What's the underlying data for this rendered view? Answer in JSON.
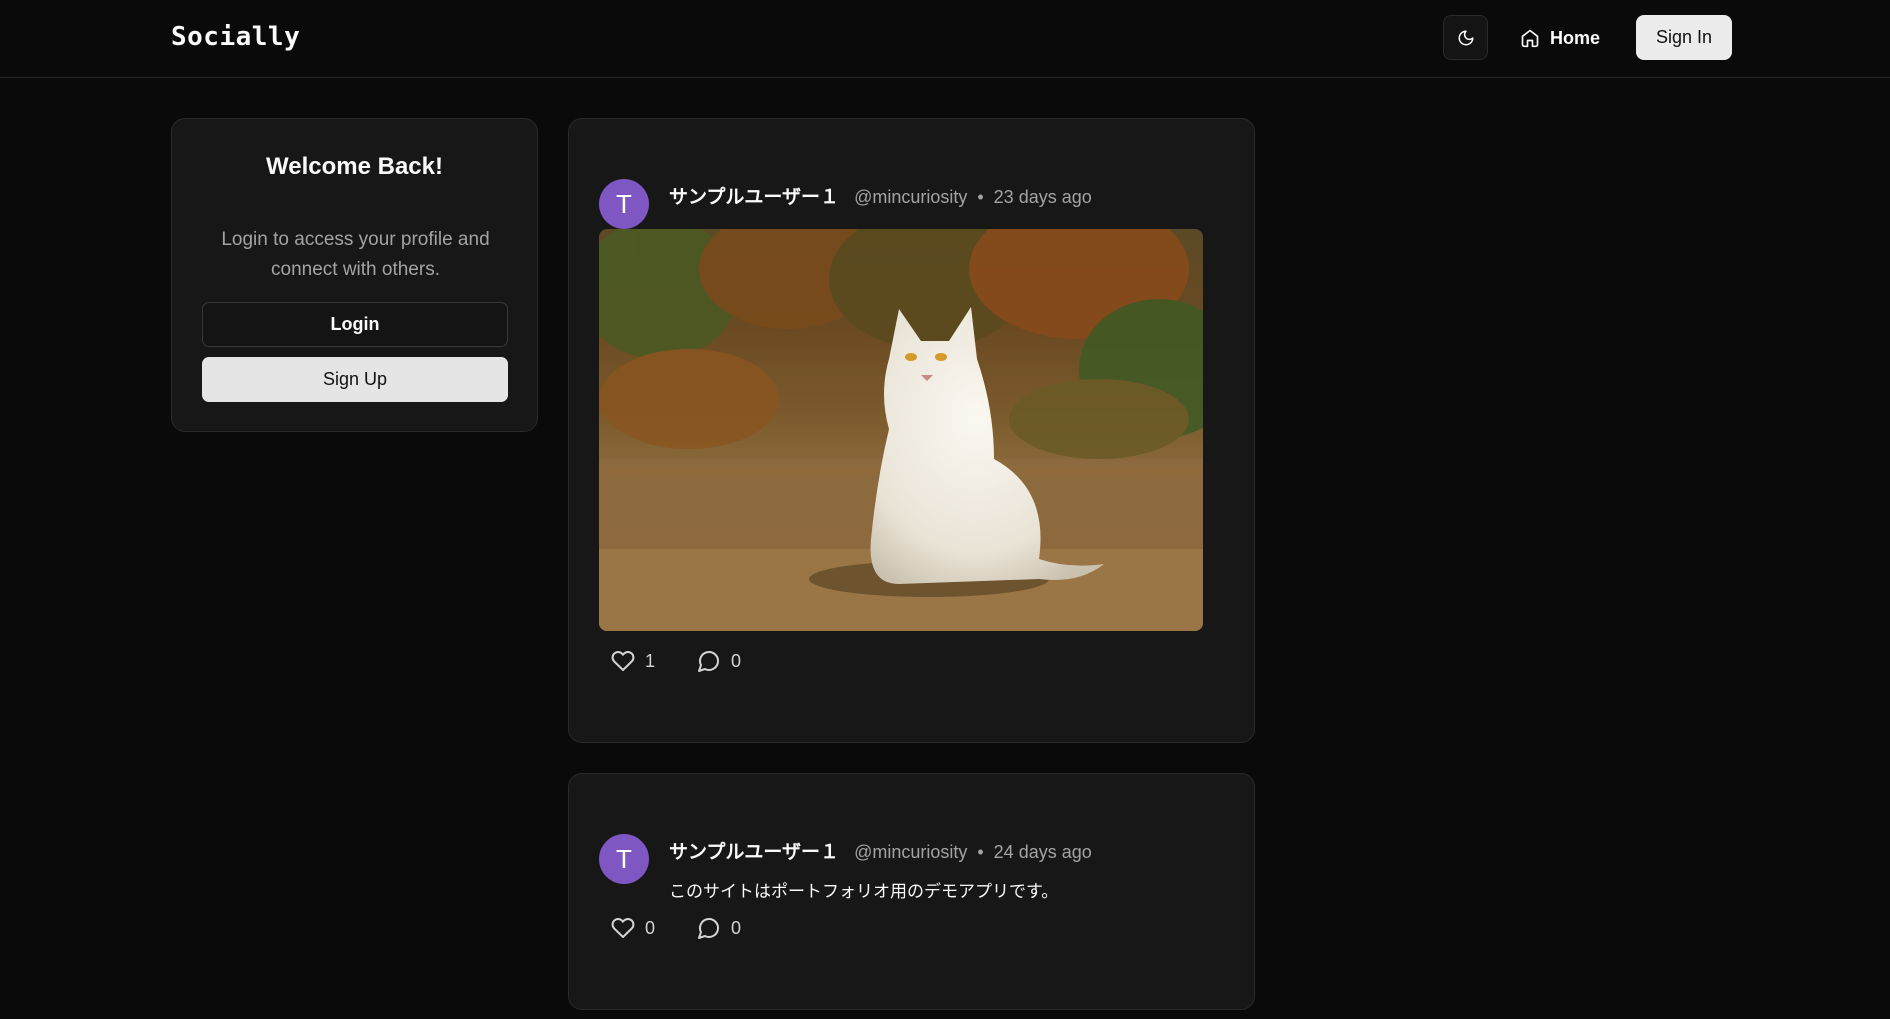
{
  "header": {
    "brand": "Socially",
    "theme_toggle_icon": "moon-icon",
    "nav_home_label": "Home",
    "sign_in_label": "Sign In"
  },
  "welcome": {
    "title": "Welcome Back!",
    "text": "Login to access your profile and connect with others.",
    "login_label": "Login",
    "signup_label": "Sign Up"
  },
  "posts": [
    {
      "avatar_initial": "T",
      "avatar_color": "#7e57c2",
      "author": "サンプルユーザー１",
      "handle": "@mincuriosity",
      "separator": "•",
      "time": "23 days ago",
      "image_description": "white-cat-photo",
      "likes": "1",
      "comments": "0"
    },
    {
      "avatar_initial": "T",
      "avatar_color": "#7e57c2",
      "author": "サンプルユーザー１",
      "handle": "@mincuriosity",
      "separator": "•",
      "time": "24 days ago",
      "text": "このサイトはポートフォリオ用のデモアプリです。",
      "likes": "0",
      "comments": "0"
    }
  ]
}
